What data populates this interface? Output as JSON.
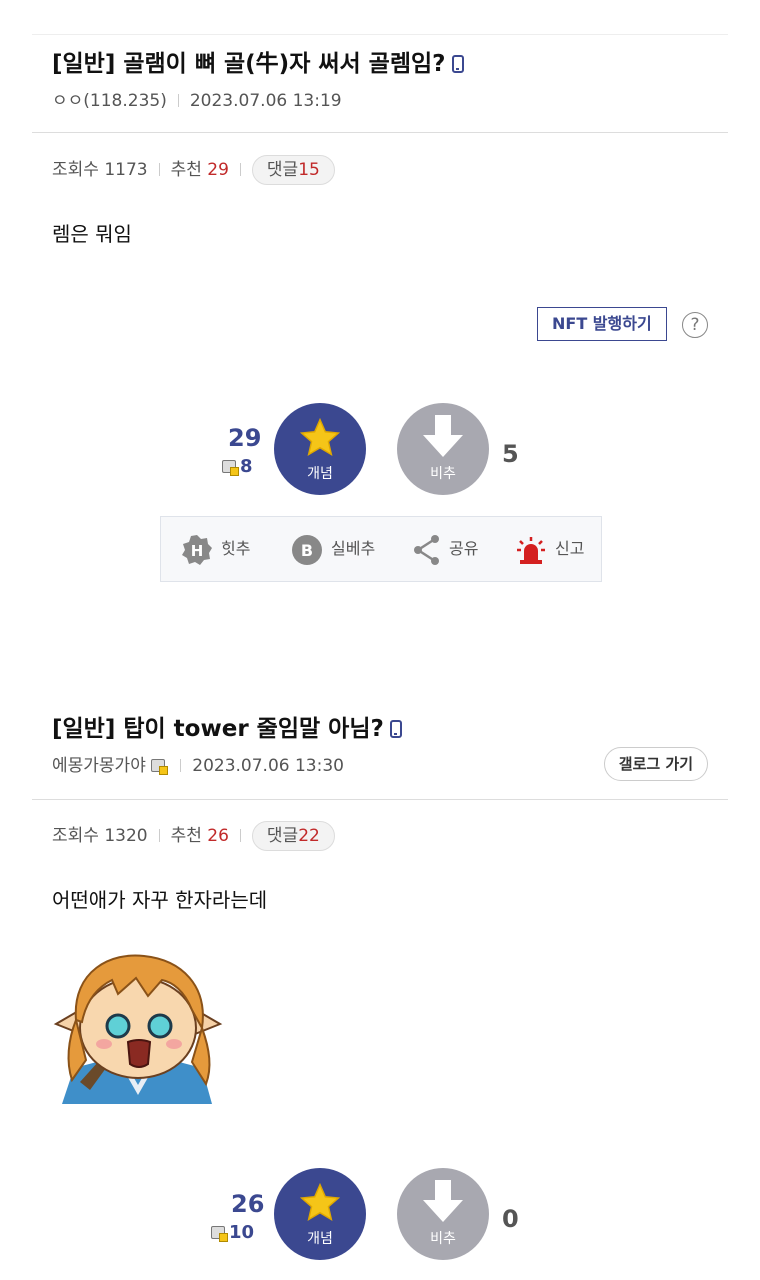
{
  "post1": {
    "title": "[일반] 골램이 뼈 골(牛)자 써서 골렘임?",
    "author": "ㅇㅇ(118.235)",
    "date": "2023.07.06 13:19",
    "views_label": "조회수 1173",
    "recommend_label": "추천",
    "recommend_count": "29",
    "comments_label": "댓글",
    "comments_count": "15",
    "body": "렘은 뭐임",
    "nft_button": "NFT 발행하기",
    "help": "?",
    "up_count": "29",
    "up_sub_count": "8",
    "up_label": "개념",
    "down_label": "비추",
    "down_count": "5",
    "actions": [
      "힛추",
      "실베추",
      "공유",
      "신고"
    ]
  },
  "post2": {
    "title": "[일반] 탑이 tower 줄임말 아님?",
    "author": "에몽가몽가야",
    "date": "2023.07.06 13:30",
    "gallog_button": "갤로그 가기",
    "views_label": "조회수 1320",
    "recommend_label": "추천",
    "recommend_count": "26",
    "comments_label": "댓글",
    "comments_count": "22",
    "body": "어떤애가 자꾸 한자라는데",
    "up_count": "26",
    "up_sub_count": "10",
    "up_label": "개념",
    "down_label": "비추",
    "down_count": "0"
  },
  "colors": {
    "brand": "#3b4890",
    "red": "#c12a2a",
    "vote_down": "#a8a8b0",
    "star": "#f5c518"
  },
  "icons": [
    "phone-icon",
    "star-icon",
    "down-arrow-icon",
    "hit-icon",
    "best-icon",
    "share-icon",
    "report-siren-icon",
    "gallery-mini-icon"
  ]
}
